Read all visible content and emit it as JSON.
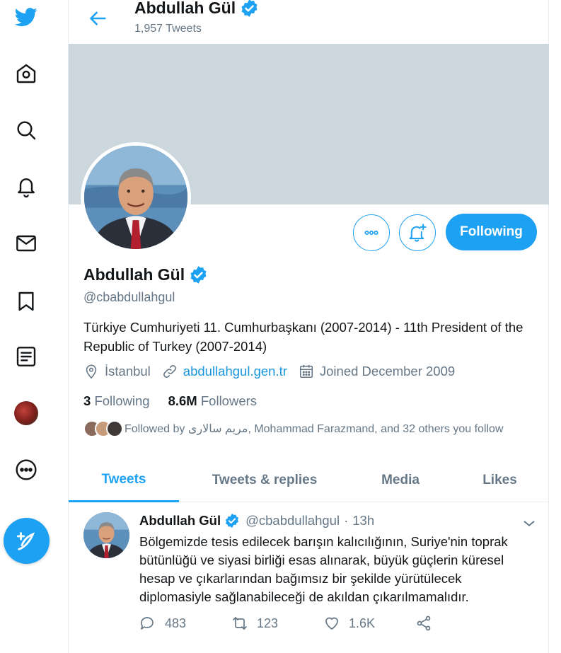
{
  "nav": {
    "items": [
      {
        "icon": "twitter-logo-icon"
      },
      {
        "icon": "home-icon"
      },
      {
        "icon": "explore-search-icon"
      },
      {
        "icon": "notifications-bell-icon"
      },
      {
        "icon": "messages-envelope-icon"
      },
      {
        "icon": "bookmarks-icon"
      },
      {
        "icon": "lists-icon"
      },
      {
        "icon": "profile-avatar"
      },
      {
        "icon": "more-icon"
      }
    ],
    "compose_icon": "compose-tweet-icon"
  },
  "header": {
    "name": "Abdullah Gül",
    "tweet_count": "1,957 Tweets"
  },
  "profile": {
    "name": "Abdullah Gül",
    "handle": "@cbabdullahgul",
    "bio": "Türkiye Cumhuriyeti 11. Cumhurbaşkanı (2007-2014) - 11th President of the Republic of Turkey (2007-2014)",
    "location": "İstanbul",
    "website": "abdullahgul.gen.tr",
    "joined": "Joined December 2009",
    "following_count": "3",
    "following_label": "Following",
    "followers_count": "8.6M",
    "followers_label": "Followers",
    "followed_by": "Followed by مریم سالاری, Mohammad Farazmand, and 32 others you follow",
    "follow_button": "Following"
  },
  "tabs": [
    {
      "label": "Tweets",
      "active": true
    },
    {
      "label": "Tweets & replies",
      "active": false
    },
    {
      "label": "Media",
      "active": false
    },
    {
      "label": "Likes",
      "active": false
    }
  ],
  "tweet": {
    "name": "Abdullah Gül",
    "handle": "@cbabdullahgul",
    "separator": "·",
    "time": "13h",
    "text": "Bölgemizde tesis edilecek barışın kalıcılığının, Suriye'nin toprak bütünlüğü ve siyasi birliği esas alınarak, büyük güçlerin küresel hesap ve çıkarlarından bağımsız bir şekilde yürütülecek diplomasiyle sağlanabileceği de akıldan çıkarılmamalıdır.",
    "replies": "483",
    "retweets": "123",
    "likes": "1.6K"
  },
  "colors": {
    "accent": "#1da1f2",
    "secondary_text": "#657786",
    "banner": "#ccd6dd"
  }
}
